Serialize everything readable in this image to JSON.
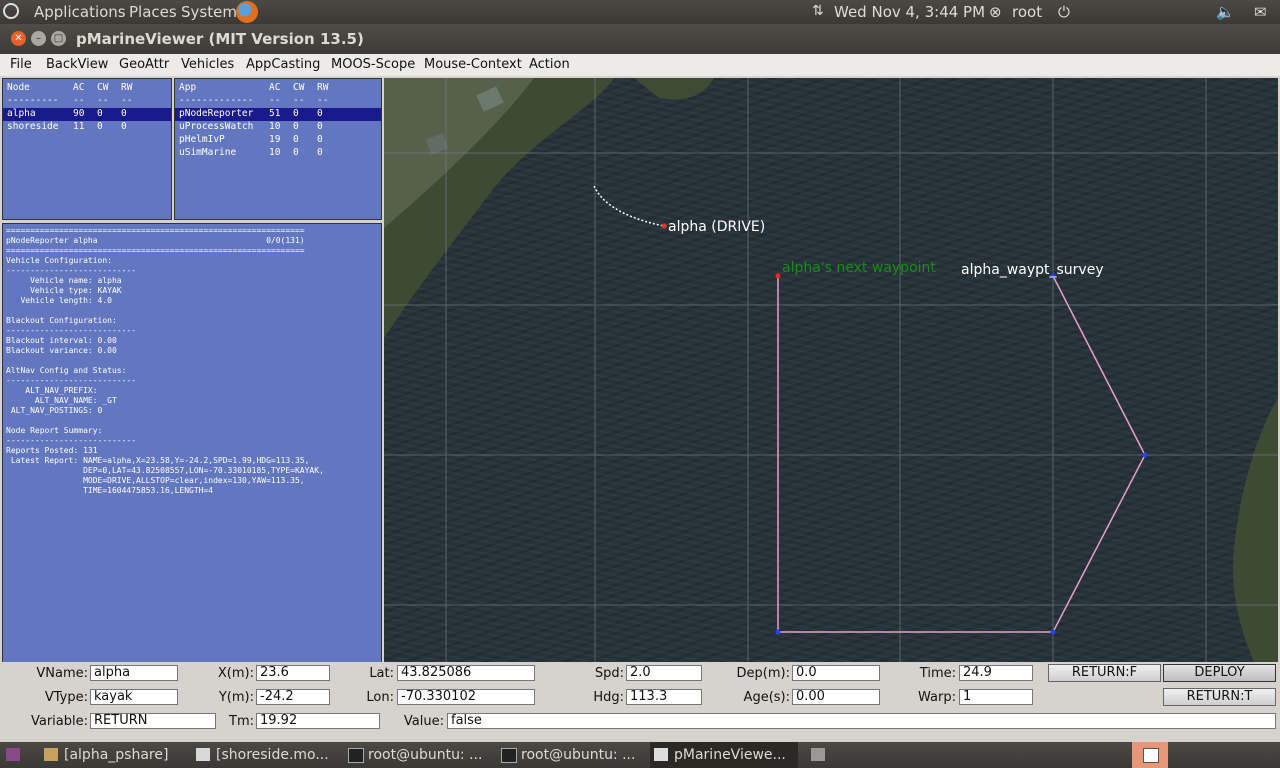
{
  "top_panel": {
    "menus": [
      "Applications",
      "Places",
      "System"
    ],
    "clock": "Wed Nov 4,  3:44 PM",
    "user": "root"
  },
  "window": {
    "title": "pMarineViewer (MIT Version 13.5)"
  },
  "menubar": [
    "File",
    "BackView",
    "GeoAttr",
    "Vehicles",
    "AppCasting",
    "MOOS-Scope",
    "Mouse-Context",
    "Action"
  ],
  "node_table": {
    "headers": [
      "Node",
      "AC",
      "CW",
      "RW"
    ],
    "divider": [
      "---------",
      "--",
      "--",
      "--"
    ],
    "rows": [
      [
        "alpha",
        "90",
        "0",
        "0"
      ],
      [
        "shoreside",
        "11",
        "0",
        "0"
      ]
    ]
  },
  "app_table": {
    "headers": [
      "App",
      "AC",
      "CW",
      "RW"
    ],
    "divider": [
      "-------------",
      "--",
      "--",
      "--"
    ],
    "rows": [
      [
        "pNodeReporter",
        "51",
        "0",
        "0"
      ],
      [
        "uProcessWatch",
        "10",
        "0",
        "0"
      ],
      [
        "pHelmIvP",
        "19",
        "0",
        "0"
      ],
      [
        "uSimMarine",
        "10",
        "0",
        "0"
      ]
    ]
  },
  "appcast_text": "==============================================================\npNodeReporter alpha                                   0/0(131)\n==============================================================\nVehicle Configuration:\n---------------------------\n     Vehicle name: alpha\n     Vehicle type: KAYAK\n   Vehicle length: 4.0\n\nBlackout Configuration:\n---------------------------\nBlackout interval: 0.00\nBlackout variance: 0.00\n\nAltNav Config and Status:\n---------------------------\n    ALT_NAV_PREFIX:\n      ALT_NAV_NAME: _GT\n ALT_NAV_POSTINGS: 0\n\nNode Report Summary:\n---------------------------\nReports Posted: 131\n Latest Report: NAME=alpha,X=23.58,Y=-24.2,SPD=1.99,HDG=113.35,\n                DEP=0,LAT=43.82508557,LON=-70.33010185,TYPE=KAYAK,\n                MODE=DRIVE,ALLSTOP=clear,index=130,YAW=113.35,\n                TIME=1604475853.16,LENGTH=4",
  "map": {
    "vehicle_label": "alpha (DRIVE)",
    "next_waypoint_label": "alpha's next waypoint",
    "survey_label": "alpha_waypt_survey"
  },
  "controls": {
    "vname_label": "VName:",
    "vname": "alpha",
    "vtype_label": "VType:",
    "vtype": "kayak",
    "variable_label": "Variable:",
    "variable": "RETURN",
    "x_label": "X(m):",
    "x": "23.6",
    "y_label": "Y(m):",
    "y": "-24.2",
    "tm_label": "Tm:",
    "tm": "19.92",
    "lat_label": "Lat:",
    "lat": "43.825086",
    "lon_label": "Lon:",
    "lon": "-70.330102",
    "value_label": "Value:",
    "value": "false",
    "spd_label": "Spd:",
    "spd": "2.0",
    "hdg_label": "Hdg:",
    "hdg": "113.3",
    "dep_label": "Dep(m):",
    "dep": "0.0",
    "age_label": "Age(s):",
    "age": "0.00",
    "time_label": "Time:",
    "time": "24.9",
    "warp_label": "Warp:",
    "warp": "1",
    "btn_return_f": "RETURN:F",
    "btn_deploy": "DEPLOY",
    "btn_return_t": "RETURN:T"
  },
  "taskbar": [
    "[alpha_pshare]",
    "[shoreside.mo...",
    "root@ubuntu: ...",
    "root@ubuntu: ...",
    "pMarineViewe..."
  ]
}
